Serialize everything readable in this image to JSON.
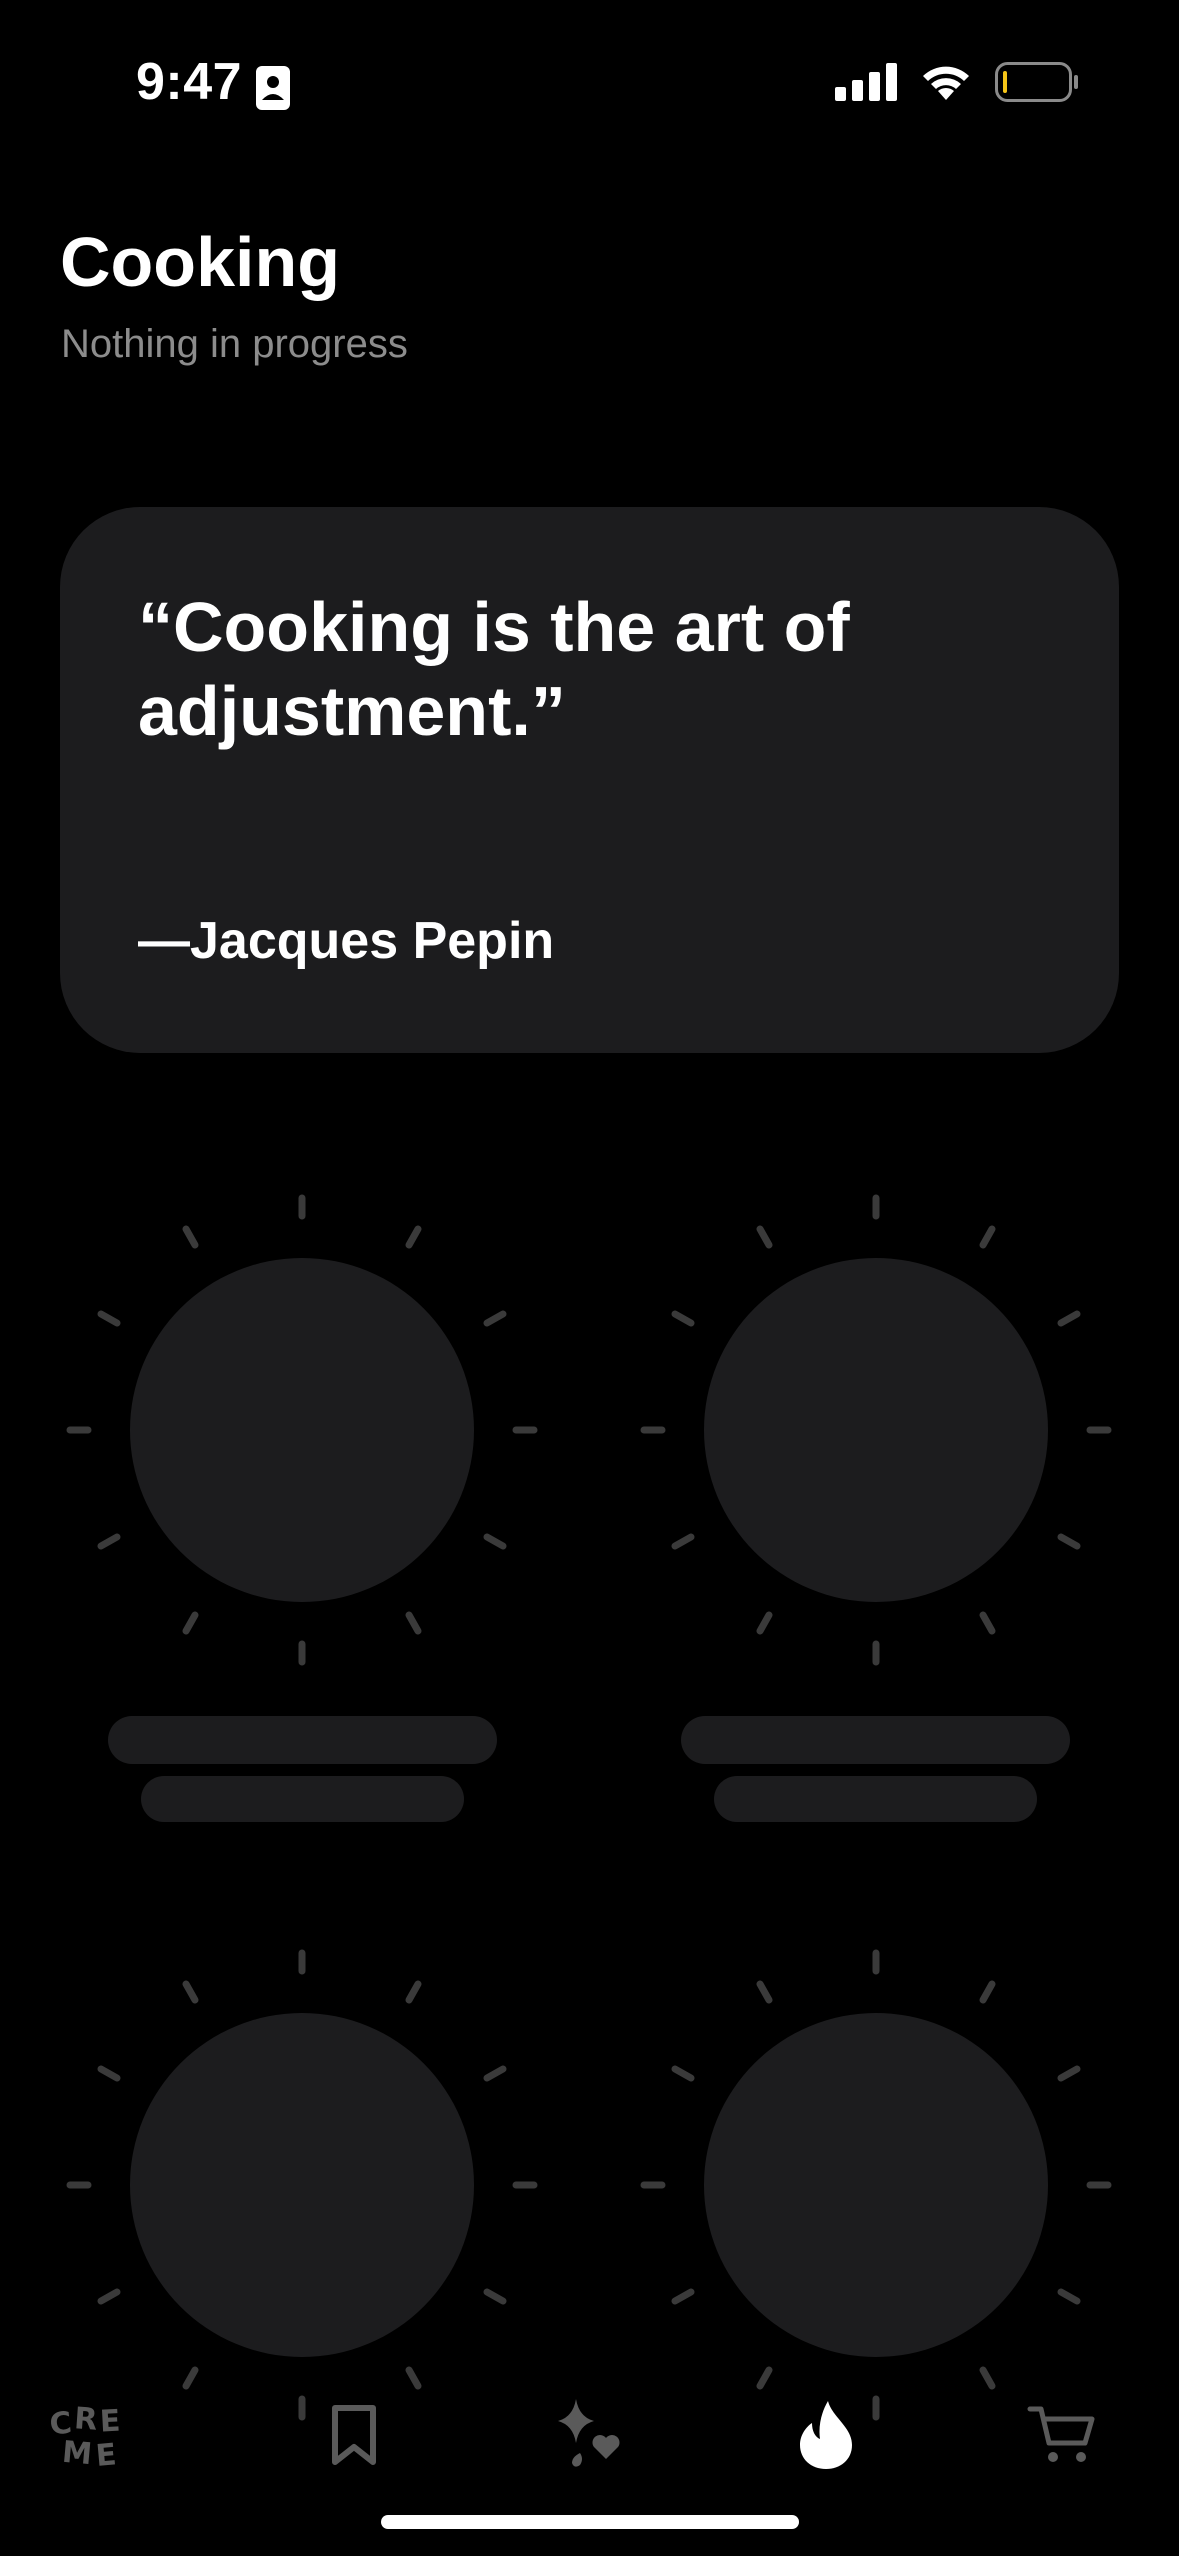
{
  "status_bar": {
    "time": "9:47"
  },
  "header": {
    "title": "Cooking",
    "subtitle": "Nothing in progress"
  },
  "quote": {
    "text": "“Cooking is the art of adjustment.”",
    "author": "—Jacques Pepin"
  },
  "tab_bar": {
    "items": [
      {
        "name": "creme-logo",
        "active": false
      },
      {
        "name": "bookmark-icon",
        "active": false
      },
      {
        "name": "sparkle-heart-icon",
        "active": false
      },
      {
        "name": "flame-icon",
        "active": true
      },
      {
        "name": "cart-icon",
        "active": false
      }
    ]
  },
  "colors": {
    "background": "#000000",
    "card": "#1c1c1e",
    "text_primary": "#ffffff",
    "text_secondary": "#8c8c8c",
    "tab_inactive": "#5a5a5a"
  }
}
